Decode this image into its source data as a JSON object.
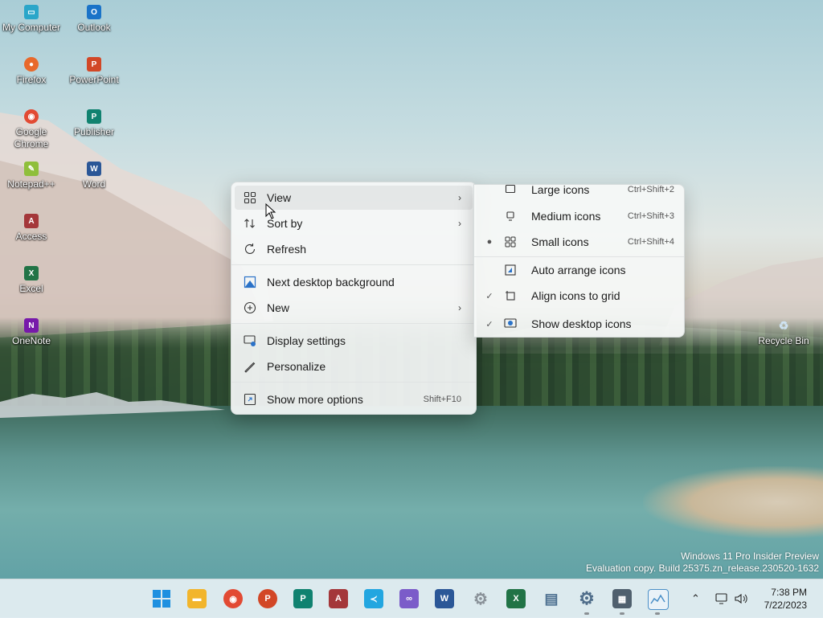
{
  "desktop": {
    "icons": [
      {
        "label": "My Computer",
        "icon": "monitor-icon",
        "color": "#2aa6c9"
      },
      {
        "label": "Outlook",
        "icon": "outlook-icon",
        "color": "#1a73c8"
      },
      {
        "label": "Firefox",
        "icon": "firefox-icon",
        "color": "#e8692b"
      },
      {
        "label": "PowerPoint",
        "icon": "powerpoint-icon",
        "color": "#d24726"
      },
      {
        "label": "Google Chrome",
        "icon": "chrome-icon",
        "color": "#e24a33"
      },
      {
        "label": "Publisher",
        "icon": "publisher-icon",
        "color": "#108270"
      },
      {
        "label": "Notepad++",
        "icon": "notepad-icon",
        "color": "#8fbf3c"
      },
      {
        "label": "Word",
        "icon": "word-icon",
        "color": "#2b5797"
      },
      {
        "label": "Access",
        "icon": "access-icon",
        "color": "#a4373a"
      },
      {
        "label": "Excel",
        "icon": "excel-icon",
        "color": "#217346"
      },
      {
        "label": "OneNote",
        "icon": "onenote-icon",
        "color": "#7719aa"
      },
      {
        "label": "Recycle Bin",
        "icon": "recycle-bin-icon",
        "color": "#6fa3c9"
      }
    ]
  },
  "context_menu": {
    "view": "View",
    "sort_by": "Sort by",
    "refresh": "Refresh",
    "next_background": "Next desktop background",
    "new": "New",
    "display_settings": "Display settings",
    "personalize": "Personalize",
    "show_more": "Show more options",
    "show_more_shortcut": "Shift+F10"
  },
  "view_submenu": {
    "large_icons": "Large icons",
    "large_icons_shortcut": "Ctrl+Shift+2",
    "medium_icons": "Medium icons",
    "medium_icons_shortcut": "Ctrl+Shift+3",
    "small_icons": "Small icons",
    "small_icons_shortcut": "Ctrl+Shift+4",
    "auto_arrange": "Auto arrange icons",
    "align_grid": "Align icons to grid",
    "show_desktop_icons": "Show desktop icons"
  },
  "watermark": {
    "line1": "Windows 11 Pro Insider Preview",
    "line2": "Evaluation copy. Build 25375.zn_release.230520-1632"
  },
  "taskbar": {
    "apps": [
      {
        "icon": "start-icon",
        "color": "#1e90e0"
      },
      {
        "icon": "file-explorer-icon",
        "color": "#f2b52c"
      },
      {
        "icon": "chrome-icon",
        "color": "#e24a33"
      },
      {
        "icon": "powerpoint-icon",
        "color": "#d24726"
      },
      {
        "icon": "publisher-icon",
        "color": "#108270"
      },
      {
        "icon": "access-icon",
        "color": "#a4373a"
      },
      {
        "icon": "vscode-icon",
        "color": "#22a6e0"
      },
      {
        "icon": "visual-studio-icon",
        "color": "#7b5cc9"
      },
      {
        "icon": "word-icon",
        "color": "#2b5797"
      },
      {
        "icon": "settings-gear-icon",
        "color": "#8a9299"
      },
      {
        "icon": "excel-icon",
        "color": "#217346"
      },
      {
        "icon": "clipboard-icon",
        "color": "#4c6f8f"
      },
      {
        "icon": "settings-icon",
        "color": "#4f6d8a"
      },
      {
        "icon": "calculator-icon",
        "color": "#50606e"
      },
      {
        "icon": "task-manager-icon",
        "color": "#4b8fc7"
      }
    ],
    "time": "7:38 PM",
    "date": "7/22/2023"
  }
}
